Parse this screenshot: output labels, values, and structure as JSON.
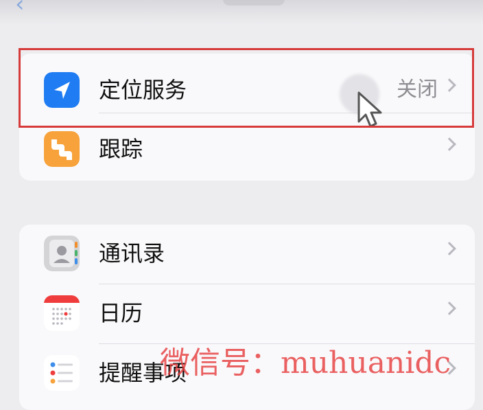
{
  "privacy_groups": [
    {
      "rows": [
        {
          "label": "定位服务",
          "value": "关闭",
          "icon": "location-arrow-icon",
          "icon_color": "#1f7cf2"
        },
        {
          "label": "跟踪",
          "value": "",
          "icon": "tracking-icon",
          "icon_color": "#f7a23b"
        }
      ]
    },
    {
      "rows": [
        {
          "label": "通讯录",
          "value": "",
          "icon": "contacts-icon",
          "icon_color": "#d4d4d6"
        },
        {
          "label": "日历",
          "value": "",
          "icon": "calendar-icon",
          "icon_color": "#ffffff"
        },
        {
          "label": "提醒事项",
          "value": "",
          "icon": "reminders-icon",
          "icon_color": "#ffffff"
        }
      ]
    }
  ],
  "watermark": {
    "text": "微信号：muhuanidc"
  },
  "colors": {
    "accent": "#1f7cf2",
    "highlight_frame": "#d63a3a",
    "secondary_text": "#8e8e93"
  }
}
